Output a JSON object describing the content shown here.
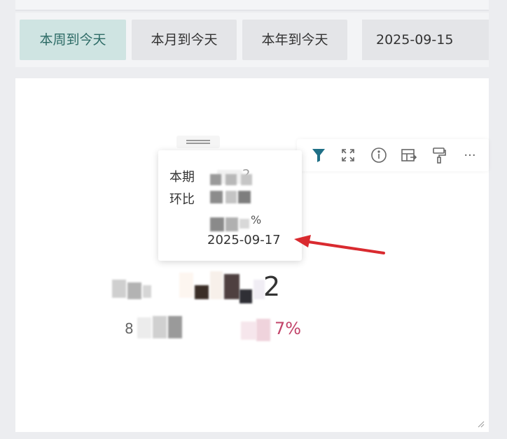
{
  "filter_bar": {
    "buttons": [
      {
        "label": "本周到今天",
        "active": true
      },
      {
        "label": "本月到今天",
        "active": false
      },
      {
        "label": "本年到今天",
        "active": false
      }
    ],
    "date_value": "2025-09-15"
  },
  "toolbar": {
    "icons": [
      "filter-icon",
      "expand-icon",
      "info-icon",
      "export-icon",
      "format-painter-icon",
      "more-icon"
    ],
    "more_label": "···"
  },
  "tooltip": {
    "row1_label": "本期",
    "row1_value_fragment": "2",
    "row2_label": "环比",
    "row3_value_fragment": "%",
    "date": "2025-09-17"
  },
  "kpi": {
    "main_value_fragment": "2",
    "change_fragment": "7%",
    "change_prefix_fragment": "8"
  },
  "colors": {
    "active_chip_bg": "#cfe4e2",
    "active_chip_text": "#2d6b66",
    "filter_icon": "#1f6f86",
    "arrow": "#d92a2f",
    "change_text": "#c2446a"
  }
}
